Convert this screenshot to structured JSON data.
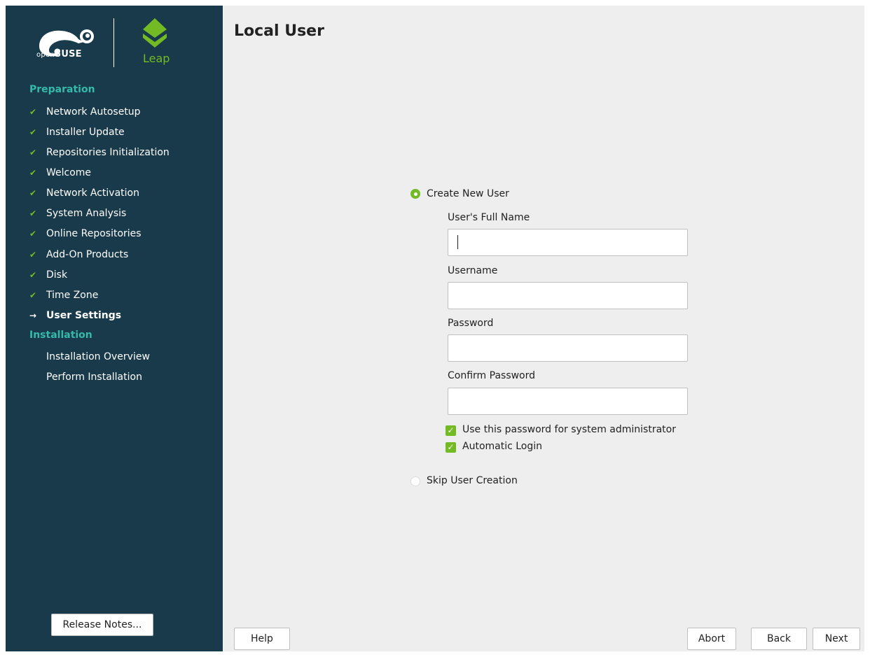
{
  "brand": {
    "opensuse_prefix": "open",
    "opensuse_name": "SUSE",
    "leap_label": "Leap",
    "colors": {
      "sidebar_bg": "#183a4b",
      "accent_green": "#73ba25",
      "section_teal": "#35b9ab"
    }
  },
  "sidebar": {
    "sections": [
      {
        "title": "Preparation",
        "items": [
          {
            "label": "Network Autosetup",
            "state": "done"
          },
          {
            "label": "Installer Update",
            "state": "done"
          },
          {
            "label": "Repositories Initialization",
            "state": "done"
          },
          {
            "label": "Welcome",
            "state": "done"
          },
          {
            "label": "Network Activation",
            "state": "done"
          },
          {
            "label": "System Analysis",
            "state": "done"
          },
          {
            "label": "Online Repositories",
            "state": "done"
          },
          {
            "label": "Add-On Products",
            "state": "done"
          },
          {
            "label": "Disk",
            "state": "done"
          },
          {
            "label": "Time Zone",
            "state": "done"
          },
          {
            "label": "User Settings",
            "state": "current"
          }
        ]
      },
      {
        "title": "Installation",
        "items": [
          {
            "label": "Installation Overview",
            "state": "pending"
          },
          {
            "label": "Perform Installation",
            "state": "pending"
          }
        ]
      }
    ],
    "release_notes_label": "Release Notes..."
  },
  "main": {
    "title": "Local User",
    "create_user": {
      "label": "Create New User",
      "selected": true
    },
    "fields": {
      "full_name": {
        "label": "User's Full Name",
        "value": ""
      },
      "username": {
        "label": "Username",
        "value": ""
      },
      "password": {
        "label": "Password",
        "value": ""
      },
      "confirm_password": {
        "label": "Confirm Password",
        "value": ""
      }
    },
    "checkboxes": {
      "use_for_admin": {
        "label": "Use this password for system administrator",
        "checked": true
      },
      "auto_login": {
        "label": "Automatic Login",
        "checked": true
      }
    },
    "skip_user": {
      "label": "Skip User Creation",
      "selected": false
    }
  },
  "buttons": {
    "help": "Help",
    "abort": "Abort",
    "back": "Back",
    "next": "Next"
  }
}
